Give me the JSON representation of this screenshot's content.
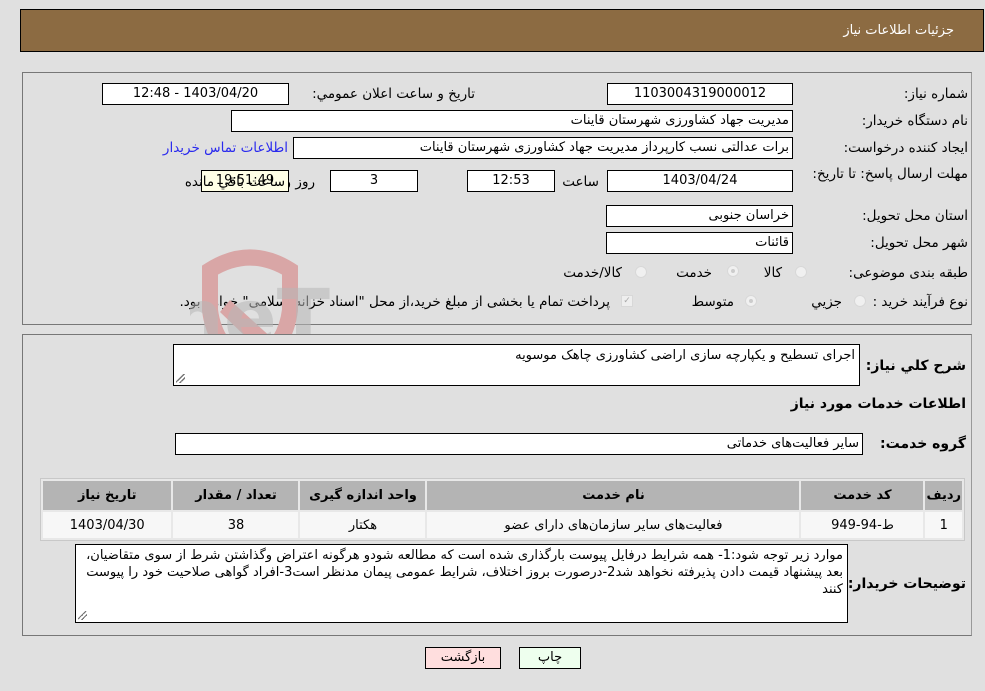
{
  "header": {
    "title": "جزئیات اطلاعات نیاز"
  },
  "details": {
    "need_number_label": "شماره نیاز:",
    "need_number": "1103004319000012",
    "announce_label": "تاریخ و ساعت اعلان عمومي:",
    "announce_value": "1403/04/20 - 12:48",
    "buyer_org_label": "نام دستگاه خريدار:",
    "buyer_org": "مدیریت جهاد کشاورزی شهرستان قاینات",
    "creator_label": "ايجاد کننده درخواست:",
    "creator": "برات عدالتی نسب کارپرداز مدیریت جهاد کشاورزی شهرستان قاینات",
    "contact_link": "اطلاعات تماس خريدار",
    "deadline_label": "مهلت ارسال پاسخ: تا تاريخ:",
    "deadline_date": "1403/04/24",
    "time_label": "ساعت",
    "deadline_time": "12:53",
    "days_value": "3",
    "days_label": "روز و",
    "remaining_time": "19:51:49",
    "remaining_label": "ساعت باقي مانده",
    "province_label": "استان محل تحویل:",
    "province": "خراسان جنوبی",
    "city_label": "شهر محل تحویل:",
    "city": "قائنات",
    "category_label": "طبقه بندی موضوعی:",
    "category_options": [
      "کالا",
      "خدمت",
      "کالا/خدمت"
    ],
    "category_selected": "خدمت",
    "process_label": "نوع فرآیند خرید :",
    "process_options": [
      "جزيي",
      "متوسط"
    ],
    "process_selected": "متوسط",
    "treasury_note": "پرداخت تمام یا بخشی از مبلغ خرید،از محل \"اسناد خزانه اسلامی\" خواهد بود."
  },
  "description": {
    "label": "شرح کلي نياز:",
    "value": "اجرای تسطیح و یکپارچه سازی اراضی کشاورزی چاهک موسویه"
  },
  "services": {
    "section_title": "اطلاعات خدمات مورد نياز",
    "group_label": "گروه خدمت:",
    "group_value": "سایر فعالیت‌های خدماتی",
    "table": {
      "headers": [
        "ردیف",
        "کد خدمت",
        "نام خدمت",
        "واحد اندازه گیری",
        "تعداد / مقدار",
        "تاریخ نیاز"
      ],
      "rows": [
        [
          "1",
          "ط-94-949",
          "فعالیت‌های سایر سازمان‌های دارای عضو",
          "هکتار",
          "38",
          "1403/04/30"
        ]
      ]
    }
  },
  "buyer_notes": {
    "label": "توضيحات خريدار:",
    "value": "موارد زیر توجه شود:1- همه شرایط درفایل پیوست بارگذاری شده است که مطالعه شودو هرگونه اعتراض وگذاشتن شرط از سوی متقاضیان، بعد پیشنهاد قیمت دادن پذیرفته نخواهد شد2-درصورت بروز اختلاف، شرایط عمومی پیمان مدنظر است3-افراد گواهی صلاحیت خود را پیوست کنند"
  },
  "buttons": {
    "print": "چاپ",
    "back": "بازگشت"
  },
  "watermark": {
    "text": "AriaTender.neT"
  }
}
